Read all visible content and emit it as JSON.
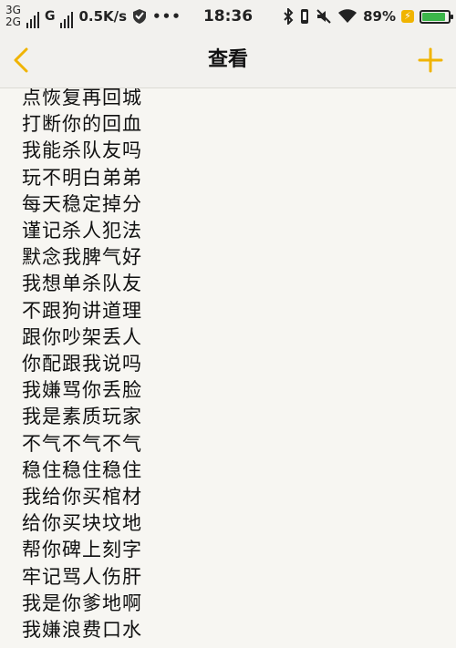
{
  "status_bar": {
    "network_top": "3G",
    "network_bottom": "2G",
    "speed": "0.5K/s",
    "more": "•••",
    "time": "18:36",
    "battery_percent": "89%",
    "battery_level": 0.89,
    "battery_color": "#3cb64a",
    "icons": [
      "signal-icon",
      "shield-icon",
      "bluetooth-icon",
      "vibrate-icon",
      "mute-icon",
      "wifi-icon",
      "charging-icon",
      "battery-icon"
    ]
  },
  "nav": {
    "title": "查看",
    "back_icon": "chevron-left-icon",
    "add_icon": "plus-icon",
    "accent_color": "#f0b400"
  },
  "note": {
    "lines": [
      "点恢复再回城",
      "打断你的回血",
      "我能杀队友吗",
      "玩不明白弟弟",
      "每天稳定掉分",
      "谨记杀人犯法",
      "默念我脾气好",
      "我想单杀队友",
      "不跟狗讲道理",
      "跟你吵架丢人",
      "你配跟我说吗",
      "我嫌骂你丢脸",
      "我是素质玩家",
      "不气不气不气",
      "稳住稳住稳住",
      "我给你买棺材",
      "给你买块坟地",
      "帮你碑上刻字",
      "牢记骂人伤肝",
      "我是你爹地啊",
      "我嫌浪费口水"
    ]
  }
}
